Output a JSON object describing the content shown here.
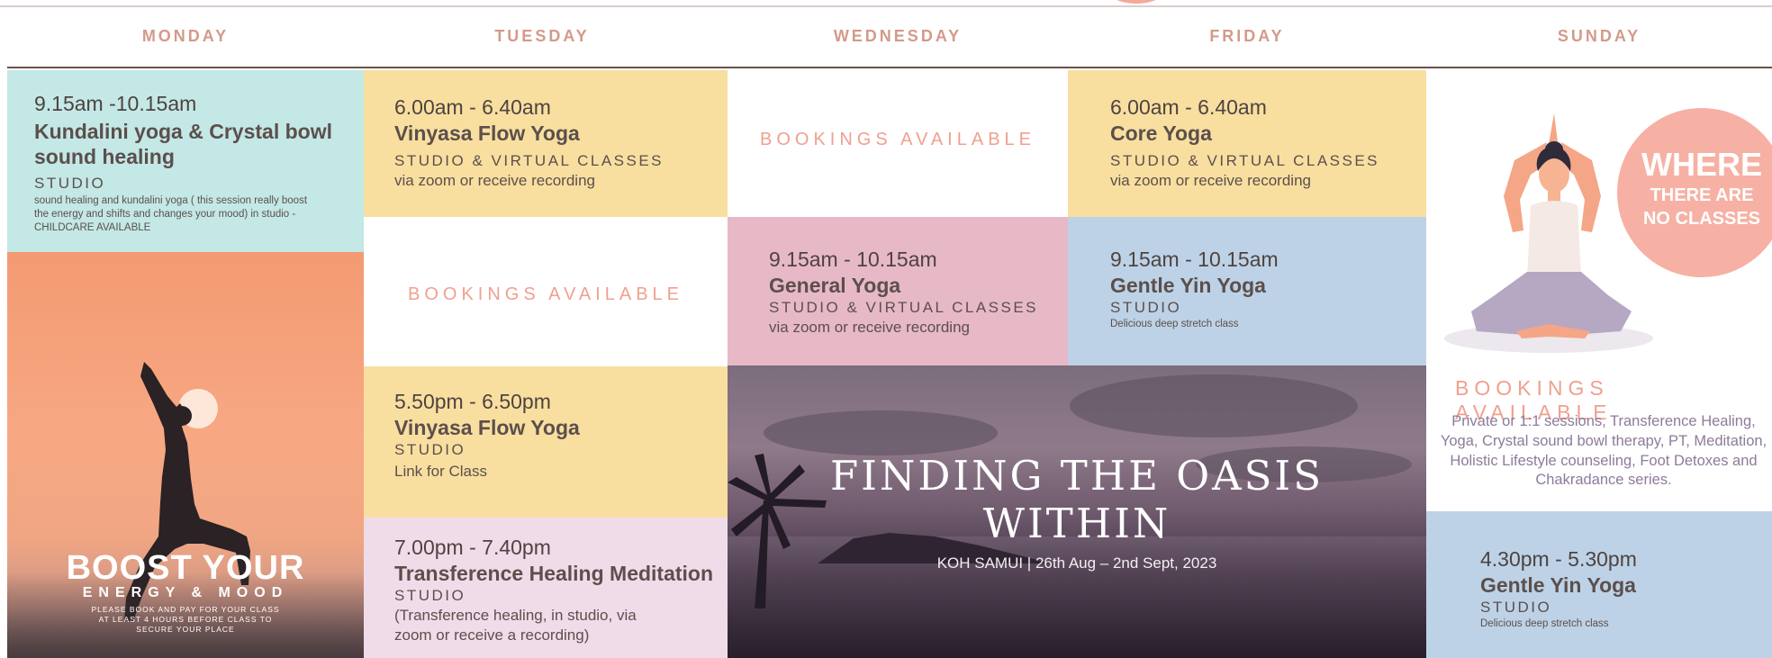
{
  "days": [
    "MONDAY",
    "TUESDAY",
    "WEDNESDAY",
    "FRIDAY",
    "SUNDAY"
  ],
  "monday": {
    "class1": {
      "time": "9.15am -10.15am",
      "title": "Kundalini yoga & Crystal bowl sound healing",
      "mode": "STUDIO",
      "note": "sound healing and kundalini yoga ( this session really boost the energy and shifts and changes your mood) in studio - CHILDCARE AVAILABLE"
    },
    "poster": {
      "headline": "BOOST YOUR",
      "subhead": "ENERGY & MOOD",
      "note": "PLEASE BOOK AND PAY FOR YOUR CLASS AT LEAST 4 HOURS BEFORE CLASS TO SECURE YOUR PLACE"
    }
  },
  "tuesday": {
    "class1": {
      "time": "6.00am - 6.40am",
      "title": "Vinyasa Flow Yoga",
      "mode": "STUDIO & VIRTUAL CLASSES",
      "note": "via zoom or receive recording"
    },
    "booking": "BOOKINGS AVAILABLE",
    "class2": {
      "time": "5.50pm - 6.50pm",
      "title": "Vinyasa Flow Yoga",
      "mode": "STUDIO",
      "note": "Link for Class"
    },
    "class3": {
      "time": "7.00pm - 7.40pm",
      "title": "Transference Healing Meditation",
      "mode": "STUDIO",
      "note": "(Transference healing, in studio, via zoom or receive a recording)"
    }
  },
  "wednesday": {
    "booking": "BOOKINGS AVAILABLE",
    "class1": {
      "time": "9.15am - 10.15am",
      "title": "General Yoga",
      "mode": "STUDIO & VIRTUAL CLASSES",
      "note": "via zoom or receive recording"
    }
  },
  "friday": {
    "class1": {
      "time": "6.00am - 6.40am",
      "title": "Core Yoga",
      "mode": "STUDIO & VIRTUAL CLASSES",
      "note": "via zoom or receive recording"
    },
    "class2": {
      "time": "9.15am - 10.15am",
      "title": "Gentle Yin Yoga",
      "mode": "STUDIO",
      "note": "Delicious deep stretch class"
    }
  },
  "oasis": {
    "title_line1": "FINDING THE OASIS",
    "title_line2": "WITHIN",
    "subtitle": "KOH SAMUI | 26th Aug – 2nd Sept, 2023"
  },
  "sunday": {
    "where_big": "WHERE",
    "where_small1": "THERE ARE",
    "where_small2": "NO CLASSES",
    "booking": "BOOKINGS AVAILABLE",
    "description": "Private or 1:1 sessions, Transference Healing, Yoga, Crystal sound bowl therapy, PT, Meditation, Holistic Lifestyle counseling, Foot Detoxes and Chakradance series.",
    "class1": {
      "time": "4.30pm - 5.30pm",
      "title": "Gentle Yin Yoga",
      "mode": "STUDIO",
      "note": "Delicious deep stretch class"
    }
  },
  "colors": {
    "teal": "#c3e8e6",
    "yellow": "#f8dfa0",
    "pink": "#e7b9c6",
    "blue": "#bdd2e6",
    "lilac": "#f0dbe9",
    "booking_accent": "#f0a08e",
    "header_text": "#d39a8a"
  }
}
